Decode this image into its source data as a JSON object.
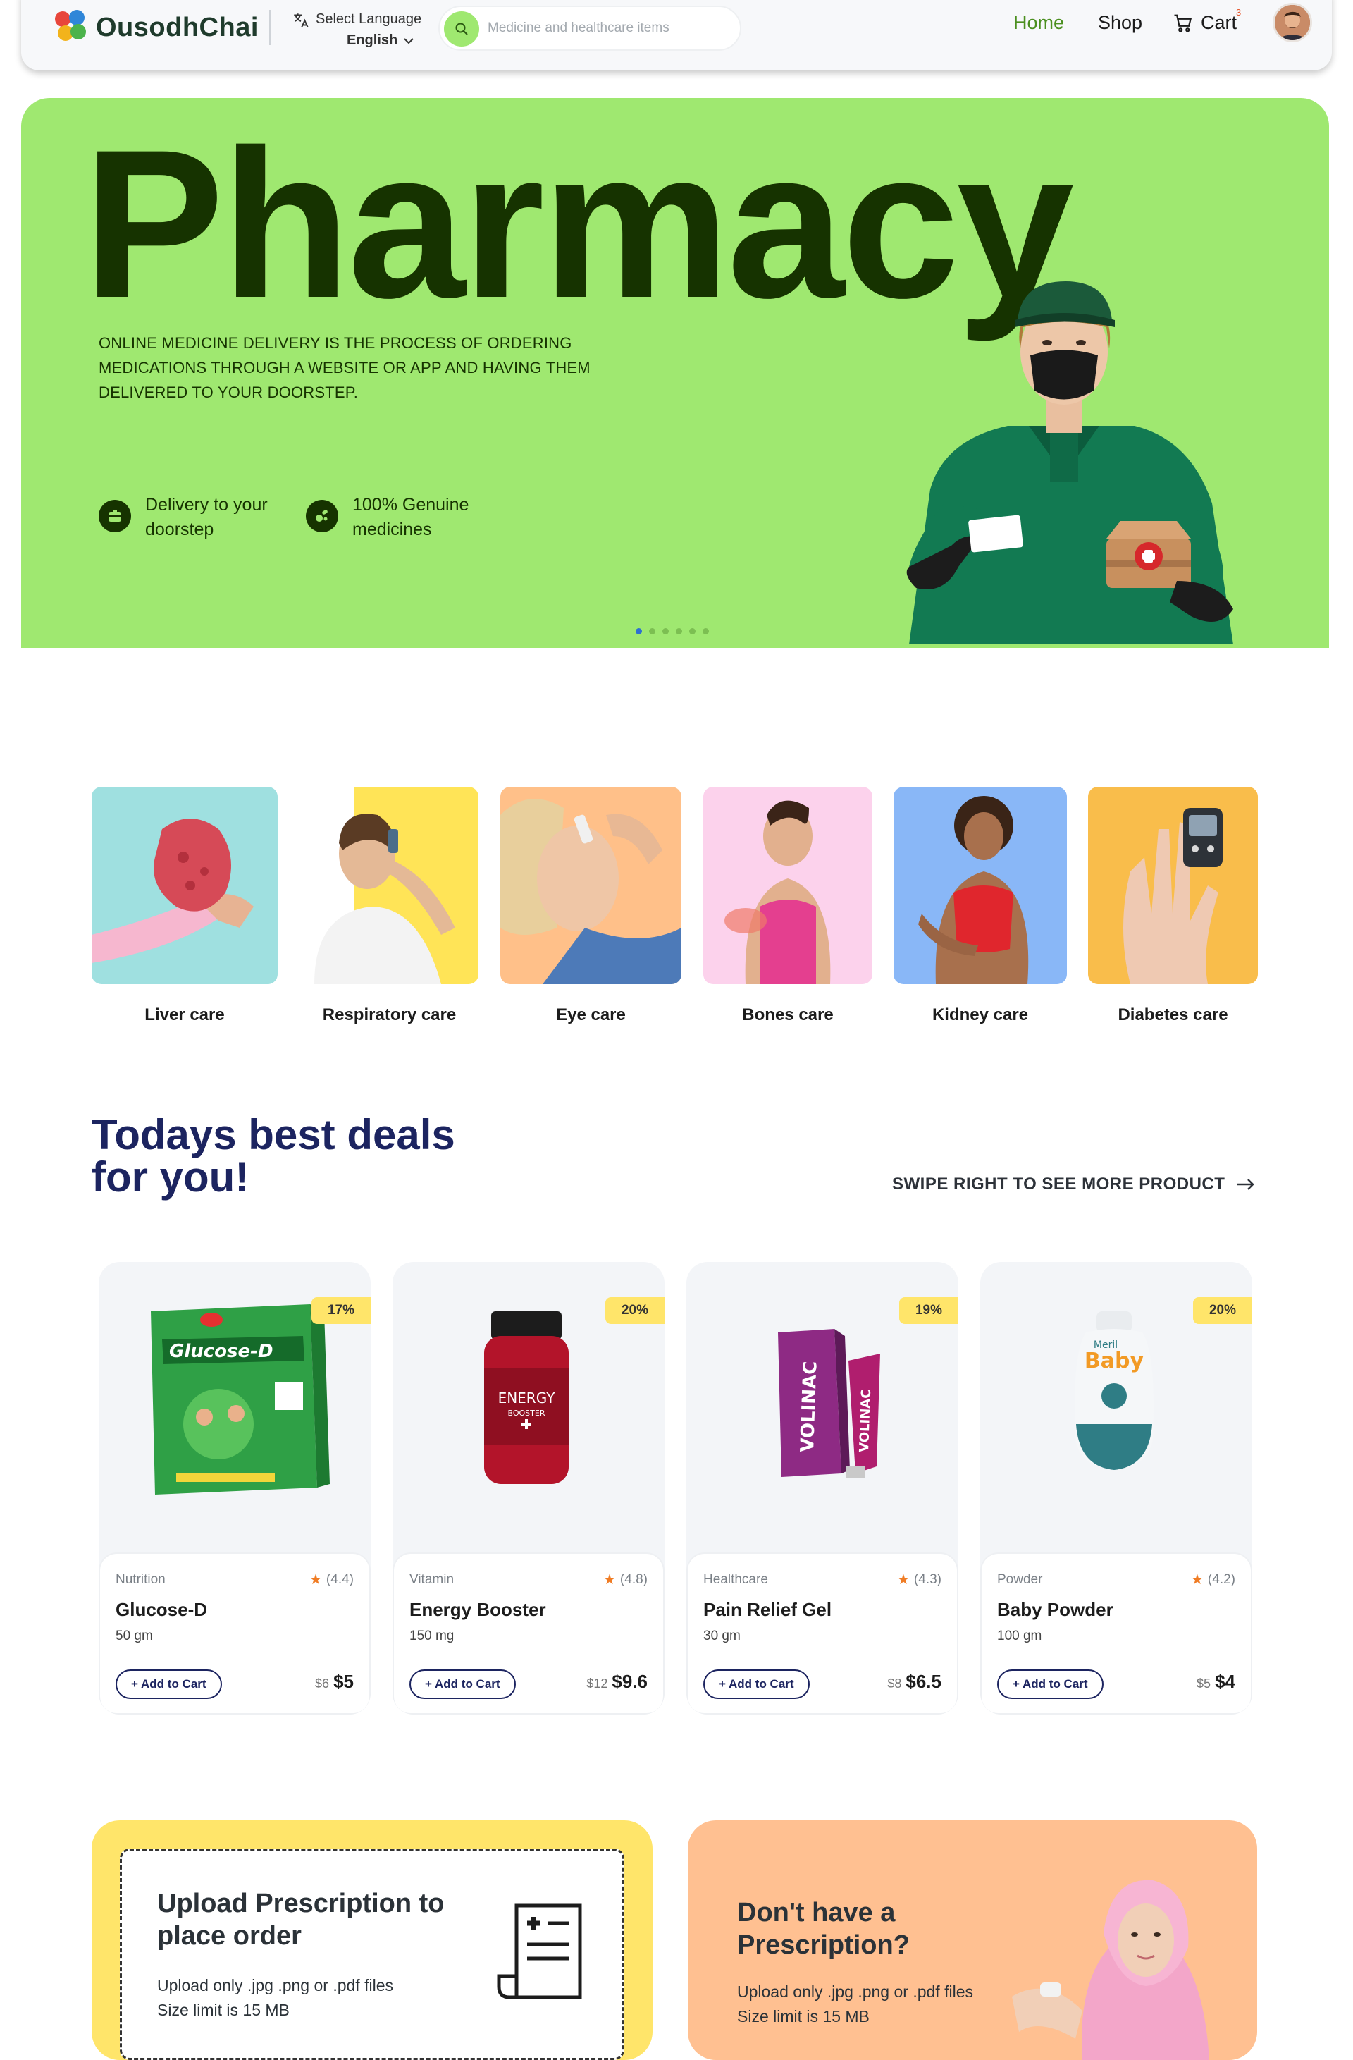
{
  "header": {
    "brand": "OusodhChai",
    "language_label": "Select Language",
    "language_value": "English",
    "search_placeholder": "Medicine and healthcare items",
    "nav": {
      "home": "Home",
      "shop": "Shop",
      "cart": "Cart"
    },
    "cart_count": "3",
    "accent_color": "#9fe870",
    "active_nav_color": "#4b8f1f"
  },
  "hero": {
    "title": "Pharmacy",
    "description": "ONLINE MEDICINE DELIVERY IS THE PROCESS OF ORDERING MEDICATIONS THROUGH A WEBSITE OR APP AND HAVING THEM DELIVERED TO YOUR DOORSTEP.",
    "features": [
      {
        "label": "Delivery to your doorstep",
        "icon": "delivery-icon"
      },
      {
        "label": "100% Genuine medicines",
        "icon": "pills-icon"
      }
    ],
    "slides": 6,
    "active_slide": 1,
    "background": "#9fe870"
  },
  "categories": [
    {
      "label": "Liver care",
      "bg": "#9fe0e0"
    },
    {
      "label": "Respiratory care",
      "bg": "#ffe457"
    },
    {
      "label": "Eye care",
      "bg": "#ffc089"
    },
    {
      "label": "Bones care",
      "bg": "#fcd2ec"
    },
    {
      "label": "Kidney care",
      "bg": "#89b7f7"
    },
    {
      "label": "Diabetes care",
      "bg": "#f9bd4b"
    }
  ],
  "deals": {
    "title": "Todays best deals for you!",
    "swipe_hint": "SWIPE RIGHT TO SEE MORE PRODUCT",
    "add_label": "+ Add to Cart",
    "products": [
      {
        "discount": "17%",
        "category": "Nutrition",
        "rating": "(4.4)",
        "name": "Glucose-D",
        "size": "50 gm",
        "old_price": "$6",
        "price": "$5"
      },
      {
        "discount": "20%",
        "category": "Vitamin",
        "rating": "(4.8)",
        "name": "Energy Booster",
        "size": "150 mg",
        "old_price": "$12",
        "price": "$9.6"
      },
      {
        "discount": "19%",
        "category": "Healthcare",
        "rating": "(4.3)",
        "name": "Pain Relief Gel",
        "size": "30 gm",
        "old_price": "$8",
        "price": "$6.5"
      },
      {
        "discount": "20%",
        "category": "Powder",
        "rating": "(4.2)",
        "name": "Baby Powder",
        "size": "100 gm",
        "old_price": "$5",
        "price": "$4"
      }
    ]
  },
  "prescription": {
    "upload_title": "Upload Prescription to place order",
    "upload_desc_1": "Upload only .jpg .png or .pdf files",
    "upload_desc_2": "Size limit is 15 MB",
    "none_title": "Don't have a Prescription?",
    "none_desc_1": "Upload only .jpg .png or .pdf files",
    "none_desc_2": "Size limit is 15 MB"
  }
}
